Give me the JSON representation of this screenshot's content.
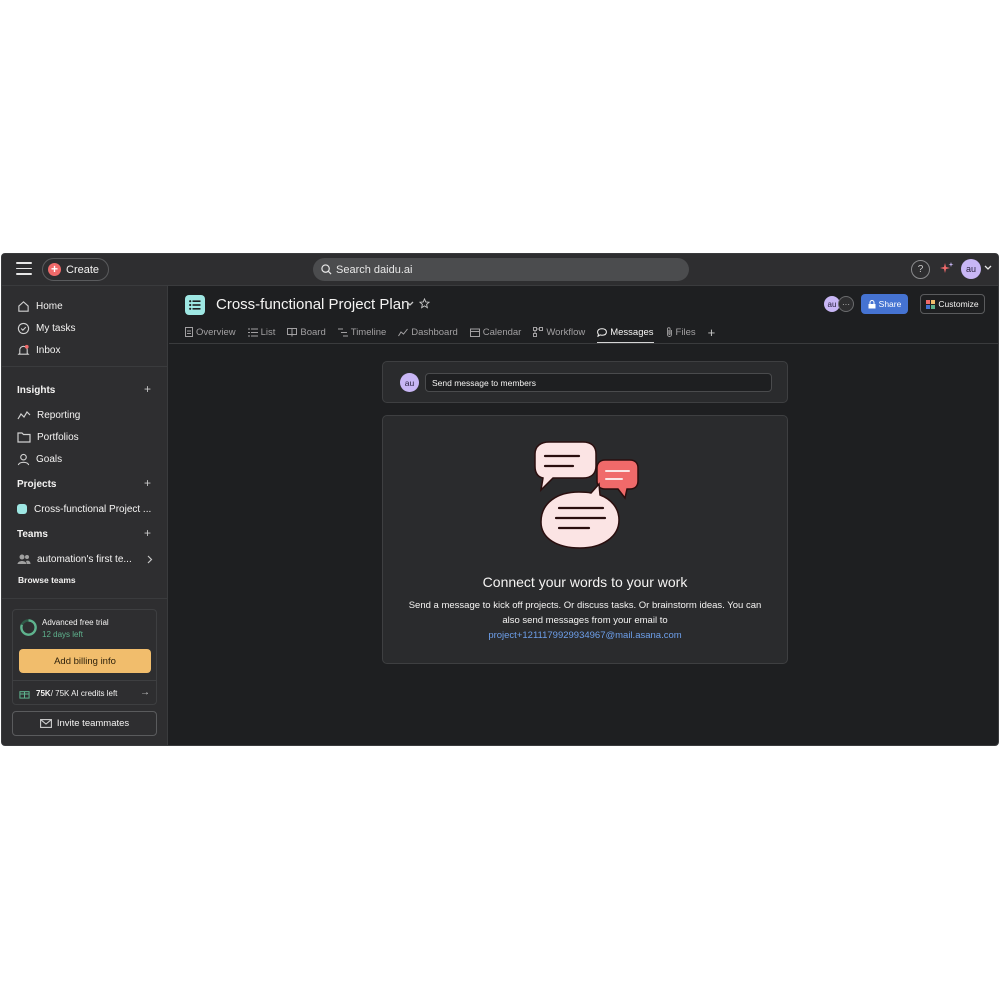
{
  "topbar": {
    "create_label": "Create",
    "search_placeholder": "Search daidu.ai",
    "help_label": "?",
    "user_initials": "au"
  },
  "sidebar": {
    "nav": [
      {
        "label": "Home",
        "icon": "home-icon"
      },
      {
        "label": "My tasks",
        "icon": "check-circle-icon"
      },
      {
        "label": "Inbox",
        "icon": "bell-icon"
      }
    ],
    "insights": {
      "title": "Insights",
      "items": [
        {
          "label": "Reporting",
          "icon": "line-chart-icon"
        },
        {
          "label": "Portfolios",
          "icon": "folder-icon"
        },
        {
          "label": "Goals",
          "icon": "person-icon"
        }
      ]
    },
    "projects": {
      "title": "Projects",
      "items": [
        {
          "label": "Cross-functional Project ...",
          "color": "#9ee7e3"
        }
      ]
    },
    "teams": {
      "title": "Teams",
      "items": [
        {
          "label": "automation's first te..."
        }
      ],
      "browse_label": "Browse teams"
    },
    "trial": {
      "title": "Advanced free trial",
      "days_left": "12 days left",
      "billing_label": "Add billing info",
      "credits_bold": "75K",
      "credits_rest": " / 75K AI credits left"
    },
    "invite_label": "Invite teammates"
  },
  "project": {
    "title": "Cross-functional Project Plan",
    "member_initials": "au",
    "share_label": "Share",
    "customize_label": "Customize",
    "tabs": [
      {
        "label": "Overview",
        "icon": "overview-icon"
      },
      {
        "label": "List",
        "icon": "list-icon"
      },
      {
        "label": "Board",
        "icon": "board-icon"
      },
      {
        "label": "Timeline",
        "icon": "timeline-icon"
      },
      {
        "label": "Dashboard",
        "icon": "dashboard-icon"
      },
      {
        "label": "Calendar",
        "icon": "calendar-icon"
      },
      {
        "label": "Workflow",
        "icon": "workflow-icon"
      },
      {
        "label": "Messages",
        "icon": "message-icon",
        "active": true
      },
      {
        "label": "Files",
        "icon": "paperclip-icon"
      }
    ]
  },
  "messages": {
    "composer_avatar": "au",
    "composer_placeholder": "Send message to members",
    "empty_title": "Connect your words to your work",
    "empty_body": "Send a message to kick off projects. Or discuss tasks. Or brainstorm ideas. You can also send messages from your email to",
    "email": "project+1211179929934967@mail.asana.com"
  },
  "colors": {
    "accent": "#4573d2",
    "billing": "#f1bd6c",
    "create": "#f06a6a",
    "link": "#6d9fea"
  }
}
